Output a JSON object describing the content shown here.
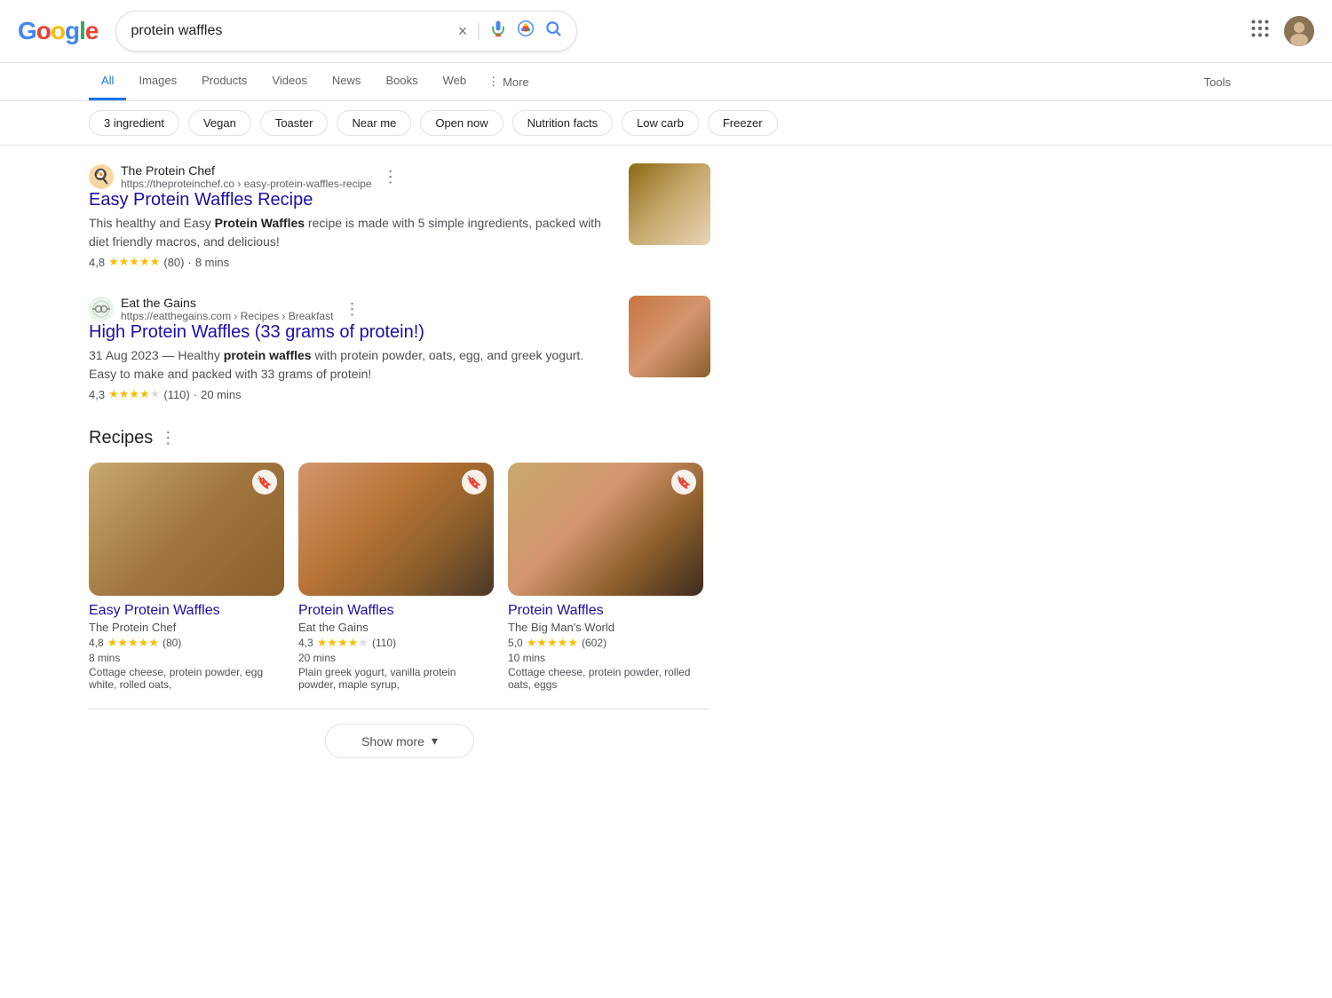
{
  "header": {
    "logo_letters": [
      "G",
      "o",
      "o",
      "g",
      "l",
      "e"
    ],
    "search_query": "protein waffles",
    "clear_label": "×",
    "voice_label": "🎤",
    "lens_label": "🔍",
    "search_label": "🔍",
    "apps_label": "⋮⋮⋮",
    "avatar_initials": "👤"
  },
  "nav": {
    "tabs": [
      {
        "id": "all",
        "label": "All",
        "active": true
      },
      {
        "id": "images",
        "label": "Images",
        "active": false
      },
      {
        "id": "products",
        "label": "Products",
        "active": false
      },
      {
        "id": "videos",
        "label": "Videos",
        "active": false
      },
      {
        "id": "news",
        "label": "News",
        "active": false
      },
      {
        "id": "books",
        "label": "Books",
        "active": false
      },
      {
        "id": "web",
        "label": "Web",
        "active": false
      }
    ],
    "more_label": "More",
    "tools_label": "Tools"
  },
  "filters": [
    {
      "id": "3-ingredient",
      "label": "3 ingredient"
    },
    {
      "id": "vegan",
      "label": "Vegan"
    },
    {
      "id": "toaster",
      "label": "Toaster"
    },
    {
      "id": "near-me",
      "label": "Near me"
    },
    {
      "id": "open-now",
      "label": "Open now"
    },
    {
      "id": "nutrition-facts",
      "label": "Nutrition facts"
    },
    {
      "id": "low-carb",
      "label": "Low carb"
    },
    {
      "id": "freezer",
      "label": "Freezer"
    }
  ],
  "results": [
    {
      "id": "result-1",
      "site_name": "The Protein Chef",
      "url": "https://theproteinchef.co › easy-protein-waffles-recipe",
      "title": "Easy Protein Waffles Recipe",
      "snippet": "This healthy and Easy <b>Protein Waffles</b> recipe is made with 5 simple ingredients, packed with diet friendly macros, and delicious!",
      "snippet_text": "This healthy and Easy Protein Waffles recipe is made with 5 simple ingredients, packed with diet friendly macros, and delicious!",
      "rating": "4,8",
      "rating_count": "(80)",
      "time": "8 mins",
      "favicon_icon": "🍳",
      "image_class": "waffle-small-1"
    },
    {
      "id": "result-2",
      "site_name": "Eat the Gains",
      "url": "https://eatthegains.com › Recipes › Breakfast",
      "title": "High Protein Waffles (33 grams of protein!)",
      "date": "31 Aug 2023",
      "snippet_text": "Healthy protein waffles with protein powder, oats, egg, and greek yogurt. Easy to make and packed with 33 grams of protein!",
      "rating": "4,3",
      "rating_count": "(110)",
      "time": "20 mins",
      "favicon_icon": "💪",
      "image_class": "waffle-small-2"
    }
  ],
  "recipes_section": {
    "title": "Recipes",
    "cards": [
      {
        "id": "recipe-1",
        "name": "Easy Protein Waffles",
        "source": "The Protein Chef",
        "rating": "4,8",
        "rating_count": "(80)",
        "time": "8 mins",
        "ingredients": "Cottage cheese, protein powder, egg white, rolled oats,",
        "image_class": "waffle-img-1"
      },
      {
        "id": "recipe-2",
        "name": "Protein Waffles",
        "source": "Eat the Gains",
        "rating": "4,3",
        "rating_count": "(110)",
        "time": "20 mins",
        "ingredients": "Plain greek yogurt, vanilla protein powder, maple syrup,",
        "image_class": "waffle-img-2"
      },
      {
        "id": "recipe-3",
        "name": "Protein Waffles",
        "source": "The Big Man's World",
        "rating": "5,0",
        "rating_count": "(602)",
        "time": "10 mins",
        "ingredients": "Cottage cheese, protein powder, rolled oats, eggs",
        "image_class": "waffle-img-3"
      }
    ]
  },
  "show_more": {
    "label": "Show more",
    "icon": "▾"
  },
  "colors": {
    "active_tab": "#1a73e8",
    "link_blue": "#1a0dab",
    "star_gold": "#FBBC04"
  }
}
